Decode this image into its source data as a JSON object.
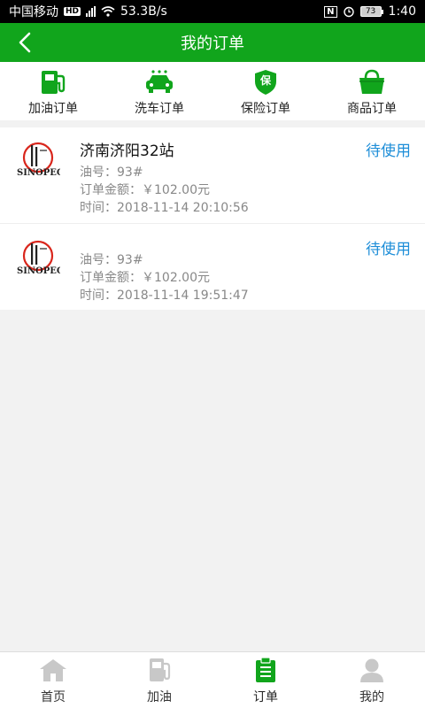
{
  "status_bar": {
    "carrier": "中国移动",
    "hd": "HD",
    "network": "4G",
    "speed": "53.3B/s",
    "nfc": "N",
    "battery": "73",
    "time": "1:40"
  },
  "header": {
    "title": "我的订单"
  },
  "tabs": [
    {
      "label": "加油订单",
      "icon": "fuel-pump-icon"
    },
    {
      "label": "洗车订单",
      "icon": "car-icon"
    },
    {
      "label": "保险订单",
      "icon": "shield-icon",
      "badge": "保"
    },
    {
      "label": "商品订单",
      "icon": "shopping-bag-icon"
    }
  ],
  "orders": [
    {
      "station": "济南济阳32站",
      "status": "待使用",
      "fuel": "油号：93#",
      "amount": "订单金额：￥102.00元",
      "time": "时间：2018-11-14 20:10:56"
    },
    {
      "station": "",
      "status": "待使用",
      "fuel": "油号：93#",
      "amount": "订单金额：￥102.00元",
      "time": "时间：2018-11-14 19:51:47"
    }
  ],
  "logo_text": "SINOPEC",
  "bottom_nav": [
    {
      "label": "首页",
      "icon": "home-icon"
    },
    {
      "label": "加油",
      "icon": "fuel-pump-icon"
    },
    {
      "label": "订单",
      "icon": "clipboard-icon",
      "active": true
    },
    {
      "label": "我的",
      "icon": "user-icon"
    }
  ],
  "colors": {
    "brand_green": "#11a51c",
    "status_blue": "#1e8ed8",
    "inactive_gray": "#c8c8c8"
  }
}
